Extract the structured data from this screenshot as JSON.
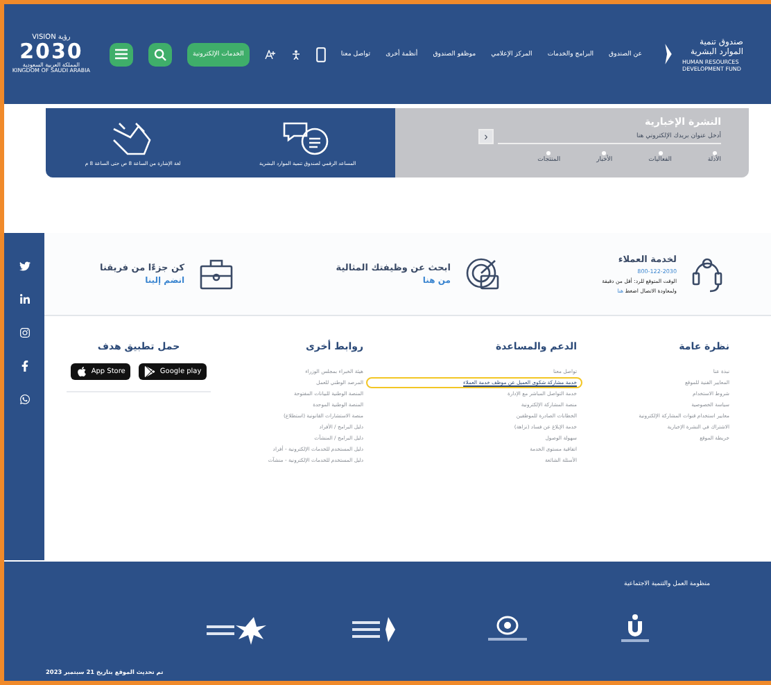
{
  "header": {
    "logo": {
      "arabic": "صندوق تنمية الموارد البشرية",
      "english": "HUMAN RESOURCES DEVELOPMENT FUND"
    },
    "nav": [
      "عن الصندوق",
      "البرامج والخدمات",
      "المركز الإعلامي",
      "موظفو الصندوق",
      "أنظمة أخرى",
      "تواصل معنا"
    ],
    "eservices_button": "الخدمات الإلكترونية",
    "vision": {
      "top": "VISION رؤية",
      "year": "2030",
      "arabic": "المملكة العربية السعودية",
      "english": "KINGDOM OF SAUDI ARABIA"
    }
  },
  "newsletter": {
    "title": "النشرة الإخبارية",
    "placeholder": "أدخل عنوان بريدك الإلكتروني هنا",
    "submit": "‹",
    "topics": [
      {
        "label": "الأدلة"
      },
      {
        "label": "الفعاليات"
      },
      {
        "label": "الأخبار"
      },
      {
        "label": "المنتجات"
      }
    ]
  },
  "help_tiles": [
    {
      "kind": "chat",
      "label": "المساعد الرقمي لصندوق تنمية الموارد البشرية"
    },
    {
      "kind": "sign",
      "label": "لغة الإشارة من الساعة 8 ص حتى الساعة 8 م"
    }
  ],
  "contact_cards": [
    {
      "kind": "headset",
      "title": "لخدمة العملاء",
      "phone": "800-122-2030",
      "note": "الوقت المتوقع للرد: أقل من دقيقة",
      "callback": "ولمعاودة الاتصال اضغط",
      "link": "هنا"
    },
    {
      "kind": "target",
      "title": "ابحث عن وظيفتك المثالية",
      "link": "من هنا"
    },
    {
      "kind": "briefcase",
      "title": "كن جزءًا من فريقنا",
      "link": "انضم إلينا"
    }
  ],
  "footer_columns": [
    {
      "title": "نظرة عامة",
      "links": [
        {
          "label": "نبذة عنا",
          "highlighted": false
        },
        {
          "label": "المعايير الفنية للموقع",
          "highlighted": false
        },
        {
          "label": "شروط الاستخدام",
          "highlighted": false
        },
        {
          "label": "سياسة الخصوصية",
          "highlighted": false
        },
        {
          "label": "معايير استخدام قنوات المشاركة الإلكترونية",
          "highlighted": false
        },
        {
          "label": "الاشتراك في النشرة الإخبارية",
          "highlighted": false
        },
        {
          "label": "خريطة الموقع",
          "highlighted": false
        }
      ]
    },
    {
      "title": "الدعم والمساعدة",
      "links": [
        {
          "label": "تواصل معنا",
          "highlighted": false
        },
        {
          "label": "خدمة مشاركة شكوى العميل عن موظف خدمة العملاء",
          "highlighted": true
        },
        {
          "label": "خدمة التواصل المباشر مع الإدارة",
          "highlighted": false
        },
        {
          "label": "منصة المشاركة الإلكترونية",
          "highlighted": false
        },
        {
          "label": "الخطابات الصادرة للموظفين",
          "highlighted": false
        },
        {
          "label": "خدمة الإبلاغ عن فساد (نزاهة)",
          "highlighted": false
        },
        {
          "label": "سهولة الوصول",
          "highlighted": false
        },
        {
          "label": "اتفاقية مستوى الخدمة",
          "highlighted": false
        },
        {
          "label": "الأسئلة الشائعة",
          "highlighted": false
        }
      ]
    },
    {
      "title": "روابط أخرى",
      "links": [
        {
          "label": "هيئة الخبراء بمجلس الوزراء",
          "highlighted": false
        },
        {
          "label": "المرصد الوطني للعمل",
          "highlighted": false
        },
        {
          "label": "المنصة الوطنية للبيانات المفتوحة",
          "highlighted": false
        },
        {
          "label": "المنصة الوطنية الموحدة",
          "highlighted": false
        },
        {
          "label": "منصة الاستشارات القانونية (استطلاع)",
          "highlighted": false
        },
        {
          "label": "دليل البرامج / الأفراد",
          "highlighted": false
        },
        {
          "label": "دليل البرامج / المنشآت",
          "highlighted": false
        },
        {
          "label": "دليل المستخدم للخدمات الإلكترونية - أفراد",
          "highlighted": false
        },
        {
          "label": "دليل المستخدم للخدمات الإلكترونية - منشآت",
          "highlighted": false
        }
      ]
    }
  ],
  "app": {
    "title": "حمل تطبيق هدف",
    "stores": [
      {
        "kind": "google",
        "label": "Google play"
      },
      {
        "kind": "apple",
        "label": "App Store"
      }
    ]
  },
  "social": [
    {
      "kind": "twitter"
    },
    {
      "kind": "linkedin"
    },
    {
      "kind": "instagram"
    },
    {
      "kind": "facebook"
    },
    {
      "kind": "whatsapp"
    }
  ],
  "bottom": {
    "title": "منظومة العمل والتنمية الاجتماعية",
    "partners": [
      {
        "kind": "bank"
      },
      {
        "kind": "ring"
      },
      {
        "kind": "fund"
      },
      {
        "kind": "palm"
      }
    ],
    "updated": "تم تحديث الموقع بتاريخ 21 سبتمبر 2023"
  }
}
